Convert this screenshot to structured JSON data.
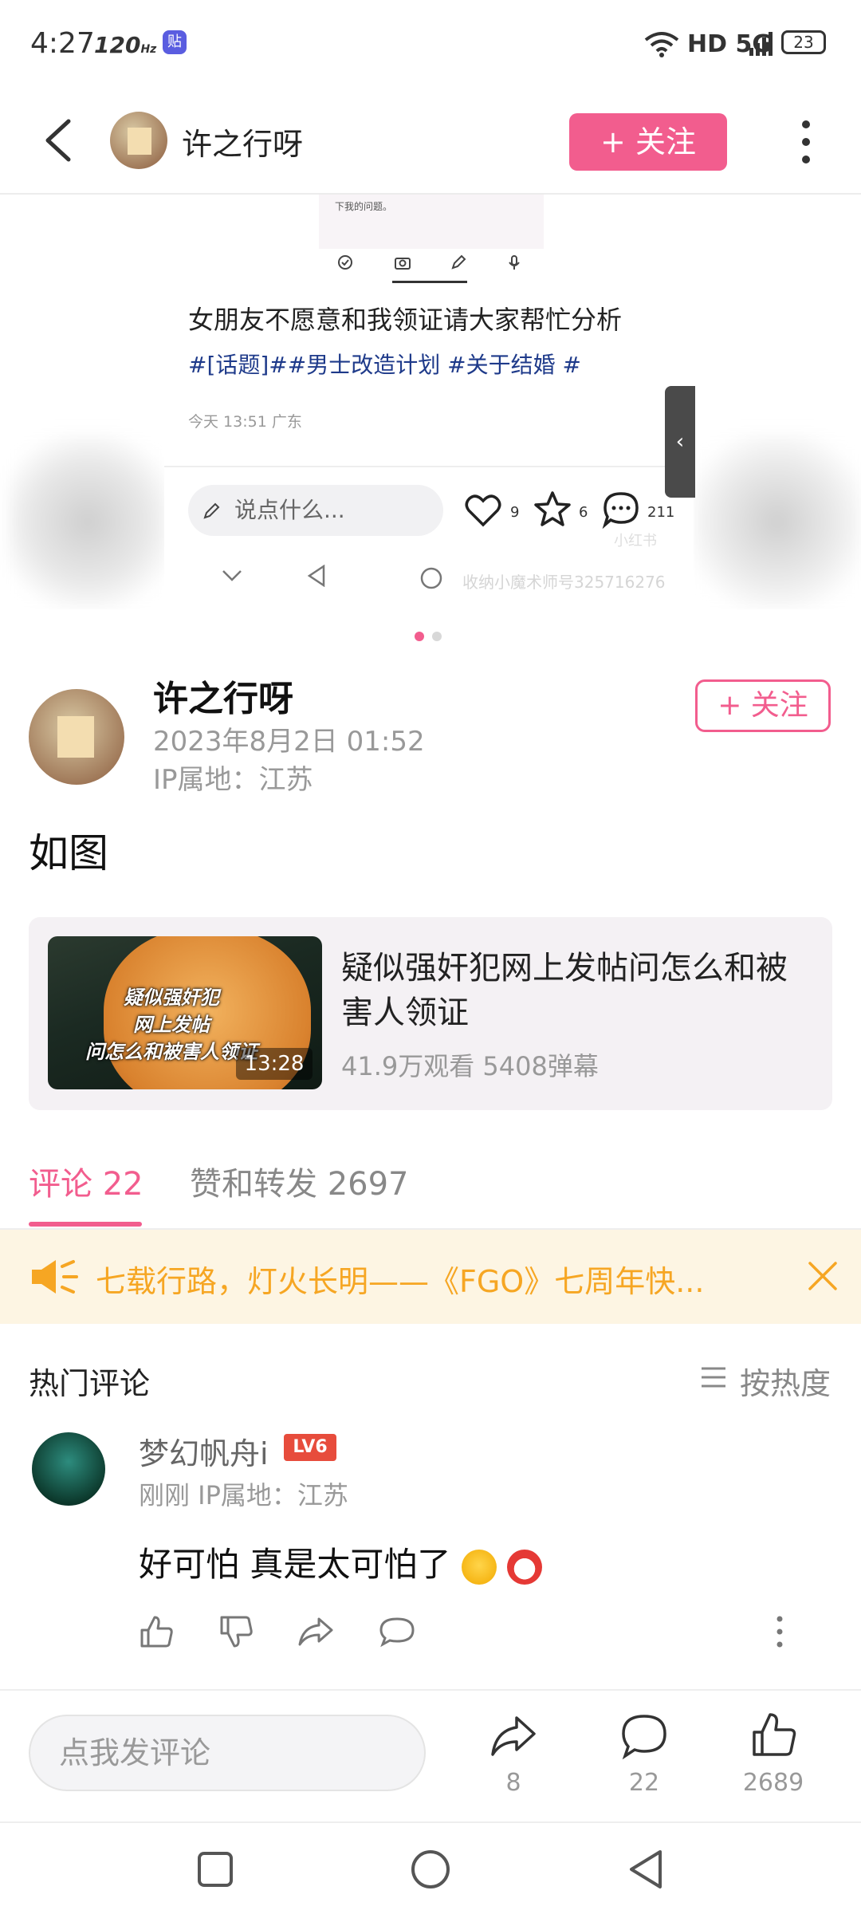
{
  "status_bar": {
    "time": "4:27",
    "refresh": "120",
    "refresh_unit": "Hz",
    "app_badge": "贴",
    "network": "HD 5G",
    "battery": "23"
  },
  "header": {
    "username": "许之行呀",
    "follow_label": "+ 关注"
  },
  "carousel": {
    "snippet_text": "下我的问题。",
    "post_title": "女朋友不愿意和我领证请大家帮忙分析",
    "post_tags": "#[话题]##男士改造计划 #关于结婚 #",
    "post_meta": "今天 13:51 广东",
    "say_placeholder": "说点什么...",
    "likes": "9",
    "stars": "6",
    "comments": "211",
    "watermark": "收纳小魔术师号325716276",
    "watermark2": "小红书",
    "handle_glyph": "‹"
  },
  "author": {
    "name": "许之行呀",
    "date": "2023年8月2日 01:52",
    "ip": "IP属地：江苏",
    "follow_label": "+ 关注"
  },
  "post": {
    "body": "如图"
  },
  "video_card": {
    "thumb_caption": "疑似强奸犯\n网上发帖\n问怎么和被害人领证",
    "duration": "13:28",
    "title": "疑似强奸犯网上发帖问怎么和被害人领证",
    "stats": "41.9万观看 5408弹幕"
  },
  "tabs": {
    "comments": "评论 22",
    "likes_shares": "赞和转发 2697"
  },
  "banner": {
    "text": "七载行路，灯火长明——《FGO》七周年快..."
  },
  "comments_section": {
    "hot_label": "热门评论",
    "sort_label": "按热度",
    "items": [
      {
        "user": "梦幻帆舟i",
        "level": "LV6",
        "meta": "刚刚  IP属地：江苏",
        "text": "好可怕 真是太可怕了"
      }
    ]
  },
  "bottom_bar": {
    "input_placeholder": "点我发评论",
    "shares": "8",
    "comments": "22",
    "likes": "2689"
  },
  "colors": {
    "accent": "#f25d8e",
    "banner_bg": "#fdf5e3",
    "banner_text": "#f6a623"
  }
}
